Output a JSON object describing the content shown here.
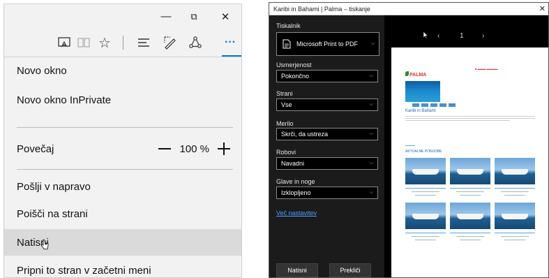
{
  "edge": {
    "window_controls": {
      "minimize": "—",
      "restore": "⧉",
      "close": "✕"
    },
    "toolbar_icons": [
      "reading-view-icon",
      "book-icon",
      "favorites-star-icon",
      "hub-icon",
      "web-note-icon",
      "share-icon",
      "more-icon"
    ],
    "more_label": "···",
    "menu": {
      "new_window": "Novo okno",
      "new_inprivate": "Novo okno InPrivate",
      "zoom_label": "Povečaj",
      "zoom_value": "100 %",
      "send_to_device": "Pošlji v napravo",
      "find_on_page": "Poišči na strani",
      "print": "Natisni",
      "pin_to_start": "Pripni to stran v začetni meni"
    }
  },
  "print_dialog": {
    "title": "Karibi in Bahami | Palma – tiskanje",
    "close": "✕",
    "printer_label": "Tiskalnik",
    "printer_value": "Microsoft Print to PDF",
    "orientation_label": "Usmerjenost",
    "orientation_value": "Pokončno",
    "pages_label": "Strani",
    "pages_value": "Vse",
    "scale_label": "Merilo",
    "scale_value": "Skrči, da ustreza",
    "margins_label": "Robovi",
    "margins_value": "Navadni",
    "headers_label": "Glave in noge",
    "headers_value": "Izklopljeno",
    "more_settings": "Več nastavitev",
    "print_button": "Natisni",
    "cancel_button": "Prekliči",
    "page_number": "1",
    "preview": {
      "logo": "PALMA",
      "heading": "Karibi in Bahami",
      "section": "AKTUALNE PONUDBE"
    }
  },
  "colors": {
    "accent": "#0078d7",
    "link": "#4aa3ff",
    "menu_highlight": "#dadada"
  }
}
